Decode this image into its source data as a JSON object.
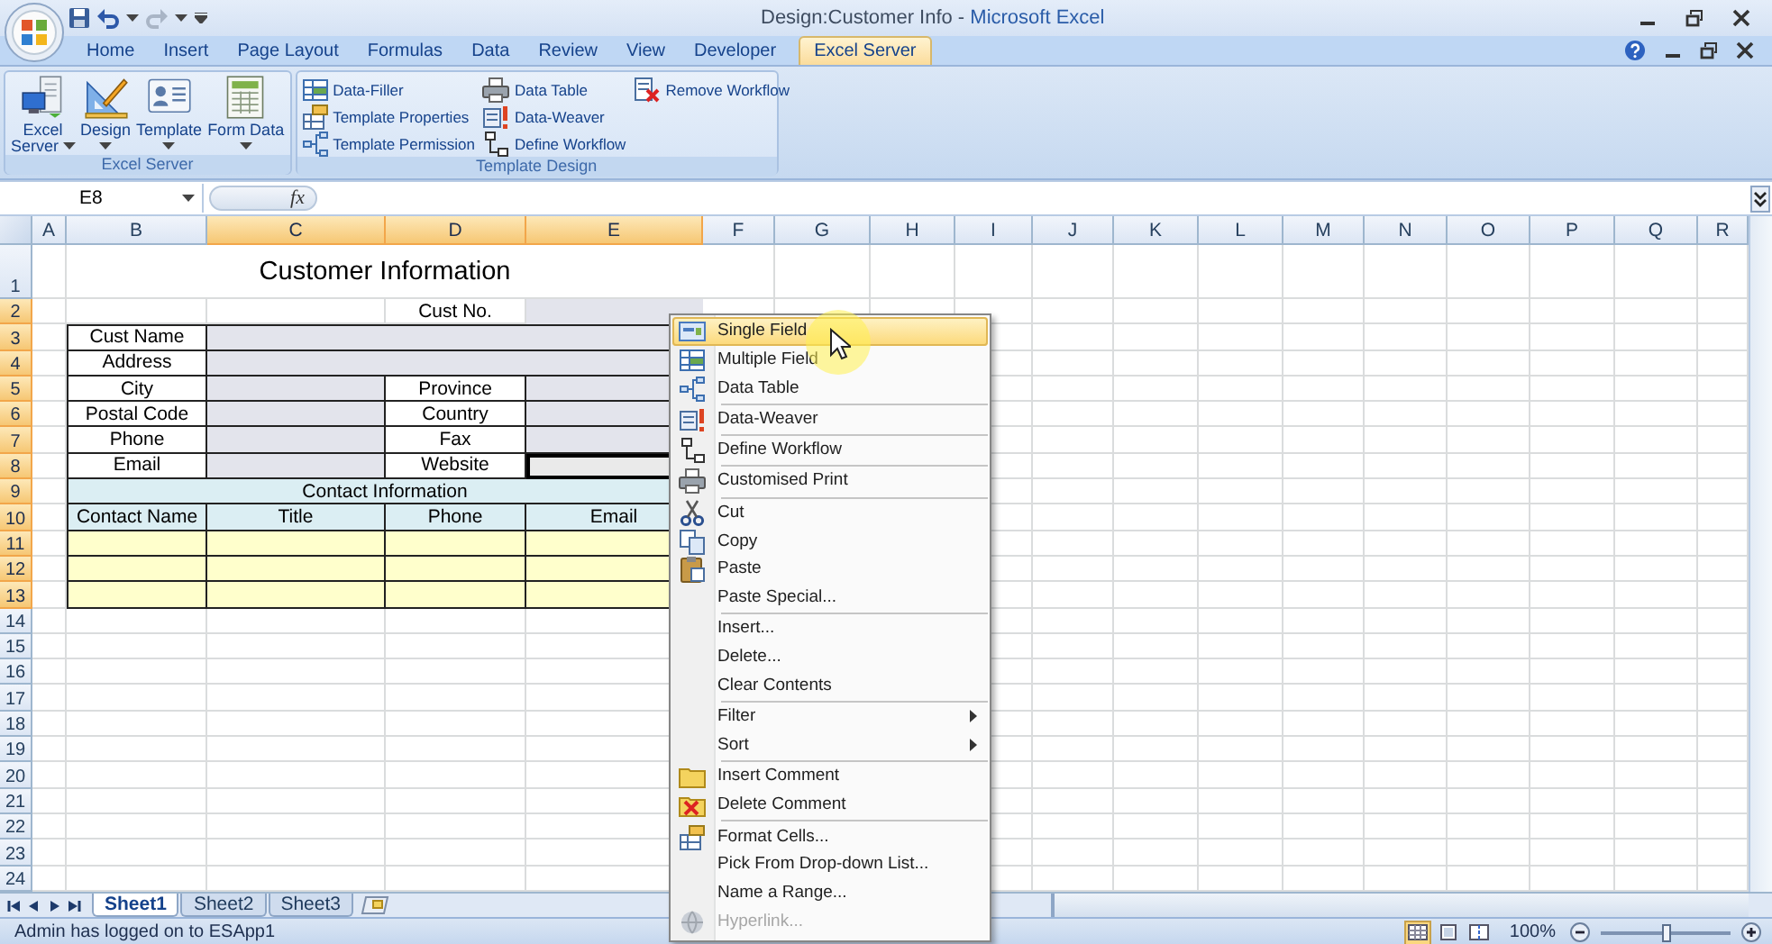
{
  "window": {
    "title": {
      "document": "Design:Customer Info - ",
      "app": "Microsoft Excel"
    }
  },
  "tabs": [
    {
      "label": "Home",
      "selected": false
    },
    {
      "label": "Insert",
      "selected": false
    },
    {
      "label": "Page Layout",
      "selected": false
    },
    {
      "label": "Formulas",
      "selected": false
    },
    {
      "label": "Data",
      "selected": false
    },
    {
      "label": "Review",
      "selected": false
    },
    {
      "label": "View",
      "selected": false
    },
    {
      "label": "Developer",
      "selected": false
    },
    {
      "label": "Excel Server",
      "selected": true
    }
  ],
  "ribbon": {
    "groups": [
      {
        "label": "Excel Server",
        "kind": "large",
        "buttons": [
          {
            "lines": [
              "Excel",
              "Server"
            ],
            "dropdown": true
          },
          {
            "lines": [
              "Design"
            ],
            "dropdown": true
          },
          {
            "lines": [
              "Template"
            ],
            "dropdown": true
          },
          {
            "lines": [
              "Form Data"
            ],
            "dropdown": true
          }
        ]
      },
      {
        "label": "Template Design",
        "kind": "small",
        "buttons": [
          {
            "label": "Data-Filler"
          },
          {
            "label": "Template Properties"
          },
          {
            "label": "Template Permission"
          },
          {
            "label": "Data Table"
          },
          {
            "label": "Data-Weaver"
          },
          {
            "label": "Define Workflow"
          },
          {
            "label": "Remove Workflow"
          }
        ]
      }
    ]
  },
  "formula_bar": {
    "name_box": "E8",
    "function_label": "fx"
  },
  "sheet": {
    "columns": [
      {
        "label": "A",
        "selected": false
      },
      {
        "label": "B",
        "selected": false
      },
      {
        "label": "C",
        "selected": true
      },
      {
        "label": "D",
        "selected": true
      },
      {
        "label": "E",
        "selected": true
      },
      {
        "label": "F",
        "selected": false
      },
      {
        "label": "G",
        "selected": false
      },
      {
        "label": "H",
        "selected": false
      },
      {
        "label": "I",
        "selected": false
      },
      {
        "label": "J",
        "selected": false
      },
      {
        "label": "K",
        "selected": false
      },
      {
        "label": "L",
        "selected": false
      },
      {
        "label": "M",
        "selected": false
      },
      {
        "label": "N",
        "selected": false
      },
      {
        "label": "O",
        "selected": false
      },
      {
        "label": "P",
        "selected": false
      },
      {
        "label": "Q",
        "selected": false
      },
      {
        "label": "R",
        "selected": false
      }
    ],
    "rows": [
      {
        "label": "1",
        "selected": false,
        "cells": [
          {
            "kind": "blank"
          },
          {
            "kind": "title",
            "text": "Customer Information"
          },
          {
            "kind": "continued"
          },
          {
            "kind": "continued"
          },
          {
            "kind": "continued"
          }
        ]
      },
      {
        "label": "2",
        "selected": true,
        "cells": [
          {
            "kind": "blank"
          },
          {
            "kind": "blank"
          },
          {
            "kind": "blank"
          },
          {
            "kind": "caption",
            "text": "Cust No."
          },
          {
            "kind": "shaded",
            "selected": false
          }
        ]
      },
      {
        "label": "3",
        "selected": true,
        "cells": [
          {
            "kind": "blank"
          },
          {
            "kind": "label",
            "text": "Cust Name"
          },
          {
            "kind": "input",
            "selected": false
          },
          {
            "kind": "continued"
          },
          {
            "kind": "continued"
          }
        ]
      },
      {
        "label": "4",
        "selected": true,
        "cells": [
          {
            "kind": "blank"
          },
          {
            "kind": "label",
            "text": "Address"
          },
          {
            "kind": "input",
            "selected": false
          },
          {
            "kind": "continued"
          },
          {
            "kind": "continued"
          }
        ]
      },
      {
        "label": "5",
        "selected": true,
        "cells": [
          {
            "kind": "blank"
          },
          {
            "kind": "label",
            "text": "City"
          },
          {
            "kind": "input",
            "selected": false
          },
          {
            "kind": "label",
            "text": "Province"
          },
          {
            "kind": "input",
            "selected": false
          }
        ]
      },
      {
        "label": "6",
        "selected": true,
        "cells": [
          {
            "kind": "blank"
          },
          {
            "kind": "label",
            "text": "Postal Code"
          },
          {
            "kind": "input",
            "selected": false
          },
          {
            "kind": "label",
            "text": "Country"
          },
          {
            "kind": "input",
            "selected": false
          }
        ]
      },
      {
        "label": "7",
        "selected": true,
        "cells": [
          {
            "kind": "blank"
          },
          {
            "kind": "label",
            "text": "Phone"
          },
          {
            "kind": "input",
            "selected": false
          },
          {
            "kind": "label",
            "text": "Fax"
          },
          {
            "kind": "input",
            "selected": false
          }
        ]
      },
      {
        "label": "8",
        "selected": true,
        "cells": [
          {
            "kind": "blank"
          },
          {
            "kind": "label",
            "text": "Email"
          },
          {
            "kind": "input",
            "selected": false
          },
          {
            "kind": "label",
            "text": "Website"
          },
          {
            "kind": "input",
            "selected": true
          }
        ]
      },
      {
        "label": "9",
        "selected": true,
        "cells": [
          {
            "kind": "blank"
          },
          {
            "kind": "section",
            "text": "Contact Information"
          },
          {
            "kind": "continued"
          },
          {
            "kind": "continued"
          },
          {
            "kind": "continued"
          }
        ]
      },
      {
        "label": "10",
        "selected": true,
        "cells": [
          {
            "kind": "blank"
          },
          {
            "kind": "head",
            "text": "Contact Name"
          },
          {
            "kind": "head",
            "text": "Title"
          },
          {
            "kind": "head",
            "text": "Phone"
          },
          {
            "kind": "head",
            "text": "Email"
          }
        ]
      },
      {
        "label": "11",
        "selected": true,
        "cells": [
          {
            "kind": "blank"
          },
          {
            "kind": "entry"
          },
          {
            "kind": "entry"
          },
          {
            "kind": "entry"
          },
          {
            "kind": "entry"
          }
        ]
      },
      {
        "label": "12",
        "selected": true,
        "cells": [
          {
            "kind": "blank"
          },
          {
            "kind": "entry"
          },
          {
            "kind": "entry"
          },
          {
            "kind": "entry"
          },
          {
            "kind": "entry"
          }
        ]
      },
      {
        "label": "13",
        "selected": true,
        "cells": [
          {
            "kind": "blank"
          },
          {
            "kind": "entry"
          },
          {
            "kind": "entry"
          },
          {
            "kind": "entry"
          },
          {
            "kind": "entry"
          }
        ]
      },
      {
        "label": "14",
        "selected": false
      },
      {
        "label": "15",
        "selected": false
      },
      {
        "label": "16",
        "selected": false
      },
      {
        "label": "17",
        "selected": false
      },
      {
        "label": "18",
        "selected": false
      },
      {
        "label": "19",
        "selected": false
      },
      {
        "label": "20",
        "selected": false
      },
      {
        "label": "21",
        "selected": false
      },
      {
        "label": "22",
        "selected": false
      },
      {
        "label": "23",
        "selected": false
      },
      {
        "label": "24",
        "selected": false
      }
    ]
  },
  "sheet_tabs": [
    {
      "label": "Sheet1",
      "selected": true
    },
    {
      "label": "Sheet2",
      "selected": false
    },
    {
      "label": "Sheet3",
      "selected": false
    }
  ],
  "status_bar": {
    "message": "Admin has logged on to ESApp1",
    "views": [
      {
        "selected": true
      },
      {
        "selected": false
      },
      {
        "selected": false
      }
    ],
    "zoom": {
      "reading": "100%",
      "level": 0.5
    }
  },
  "context_menu": {
    "sections": [
      [
        {
          "label": "Single Field",
          "selected": true,
          "disabled": false
        },
        {
          "label": "Multiple Field",
          "selected": false,
          "disabled": false
        },
        {
          "label": "Data Table",
          "selected": false,
          "disabled": false
        }
      ],
      [
        {
          "label": "Data-Weaver",
          "selected": false,
          "disabled": false
        }
      ],
      [
        {
          "label": "Define Workflow",
          "selected": false,
          "disabled": false
        }
      ],
      [
        {
          "label": "Customised Print",
          "selected": false,
          "disabled": false
        }
      ],
      [
        {
          "label": "Cut",
          "selected": false,
          "disabled": false
        },
        {
          "label": "Copy",
          "selected": false,
          "disabled": false
        },
        {
          "label": "Paste",
          "selected": false,
          "disabled": false
        },
        {
          "label": "Paste Special...",
          "selected": false,
          "disabled": false
        }
      ],
      [
        {
          "label": "Insert...",
          "selected": false,
          "disabled": false
        },
        {
          "label": "Delete...",
          "selected": false,
          "disabled": false
        },
        {
          "label": "Clear Contents",
          "selected": false,
          "disabled": false
        }
      ],
      [
        {
          "label": "Filter",
          "submenu": true,
          "selected": false,
          "disabled": false
        },
        {
          "label": "Sort",
          "submenu": true,
          "selected": false,
          "disabled": false
        }
      ],
      [
        {
          "label": "Insert Comment",
          "selected": false,
          "disabled": false
        },
        {
          "label": "Delete Comment",
          "selected": false,
          "disabled": false
        }
      ],
      [
        {
          "label": "Format Cells...",
          "selected": false,
          "disabled": false
        },
        {
          "label": "Pick From Drop-down List...",
          "selected": false,
          "disabled": false
        },
        {
          "label": "Name a Range...",
          "selected": false,
          "disabled": false
        },
        {
          "label": "Hyperlink...",
          "selected": false,
          "disabled": true
        }
      ]
    ]
  }
}
